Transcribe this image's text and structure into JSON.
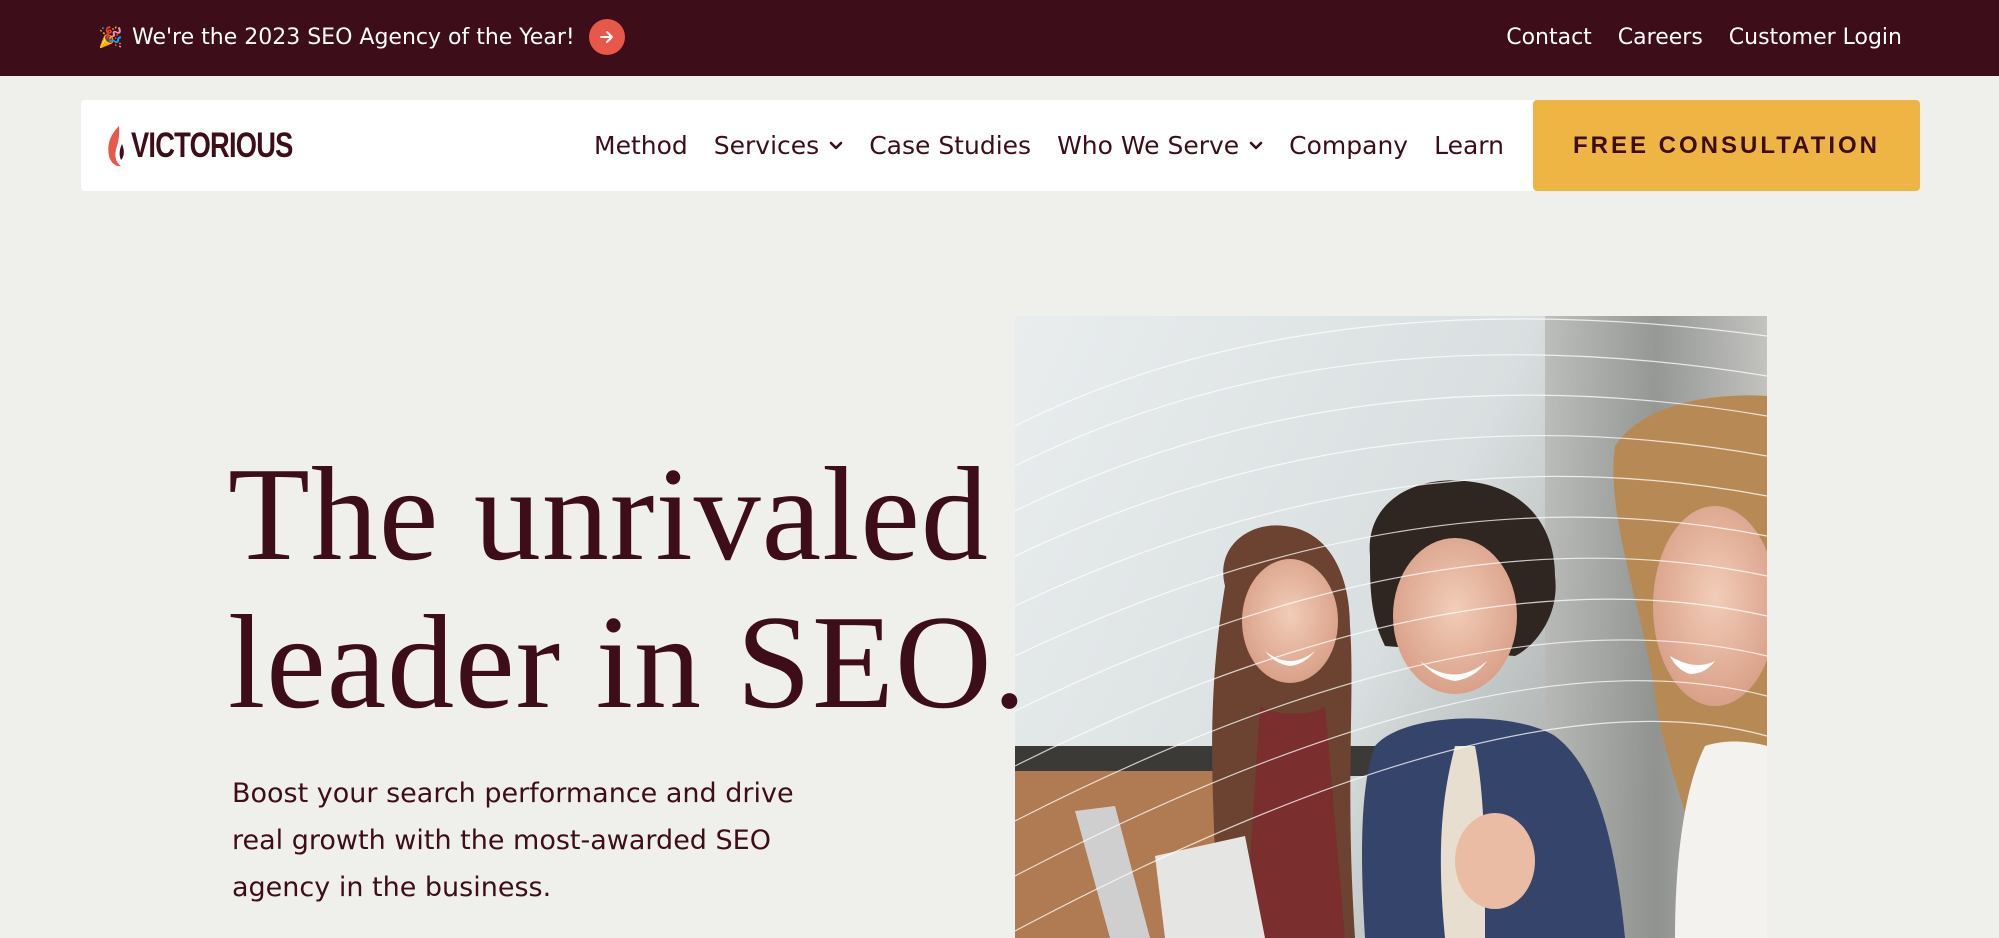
{
  "topbar": {
    "promo_emoji": "🎉",
    "promo_text": "We're the 2023 SEO Agency of the Year!",
    "promo_arrow_icon": "arrow-right-icon",
    "links": [
      "Contact",
      "Careers",
      "Customer Login"
    ]
  },
  "nav": {
    "logo_text": "VICTORIOUS",
    "logo_icon": "flame-icon",
    "items": [
      {
        "label": "Method",
        "dropdown": false
      },
      {
        "label": "Services",
        "dropdown": true
      },
      {
        "label": "Case Studies",
        "dropdown": false
      },
      {
        "label": "Who We Serve",
        "dropdown": true
      },
      {
        "label": "Company",
        "dropdown": false
      },
      {
        "label": "Learn",
        "dropdown": false
      }
    ],
    "cta_label": "FREE CONSULTATION"
  },
  "hero": {
    "title_line1": "The unrivaled",
    "title_line2": "leader in SEO.",
    "subtitle": "Boost your search performance and drive real growth with the most-awarded SEO agency in the business."
  },
  "colors": {
    "brand_dark": "#3d0e1a",
    "accent_yellow": "#efb544",
    "accent_coral": "#e8584a",
    "page_bg": "#efefeb"
  }
}
